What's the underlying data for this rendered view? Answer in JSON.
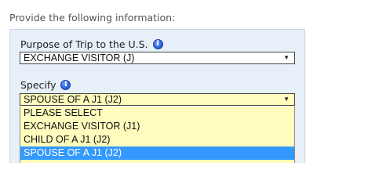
{
  "instructions": "Provide the following information:",
  "purpose": {
    "label": "Purpose of Trip to the U.S.",
    "value": "EXCHANGE VISITOR (J)",
    "info_icon": "info-icon"
  },
  "specify": {
    "label": "Specify",
    "value": "SPOUSE OF A J1 (J2)",
    "info_icon": "info-icon",
    "options": [
      {
        "label": "PLEASE SELECT"
      },
      {
        "label": "EXCHANGE VISITOR (J1)"
      },
      {
        "label": "CHILD OF A J1 (J2)"
      },
      {
        "label": "SPOUSE OF A J1 (J2)",
        "selected": true
      }
    ]
  },
  "colors": {
    "panel_bg": "#e7eff8",
    "specify_bg": "#fffcbd",
    "selected_option_bg": "#3399ff"
  }
}
